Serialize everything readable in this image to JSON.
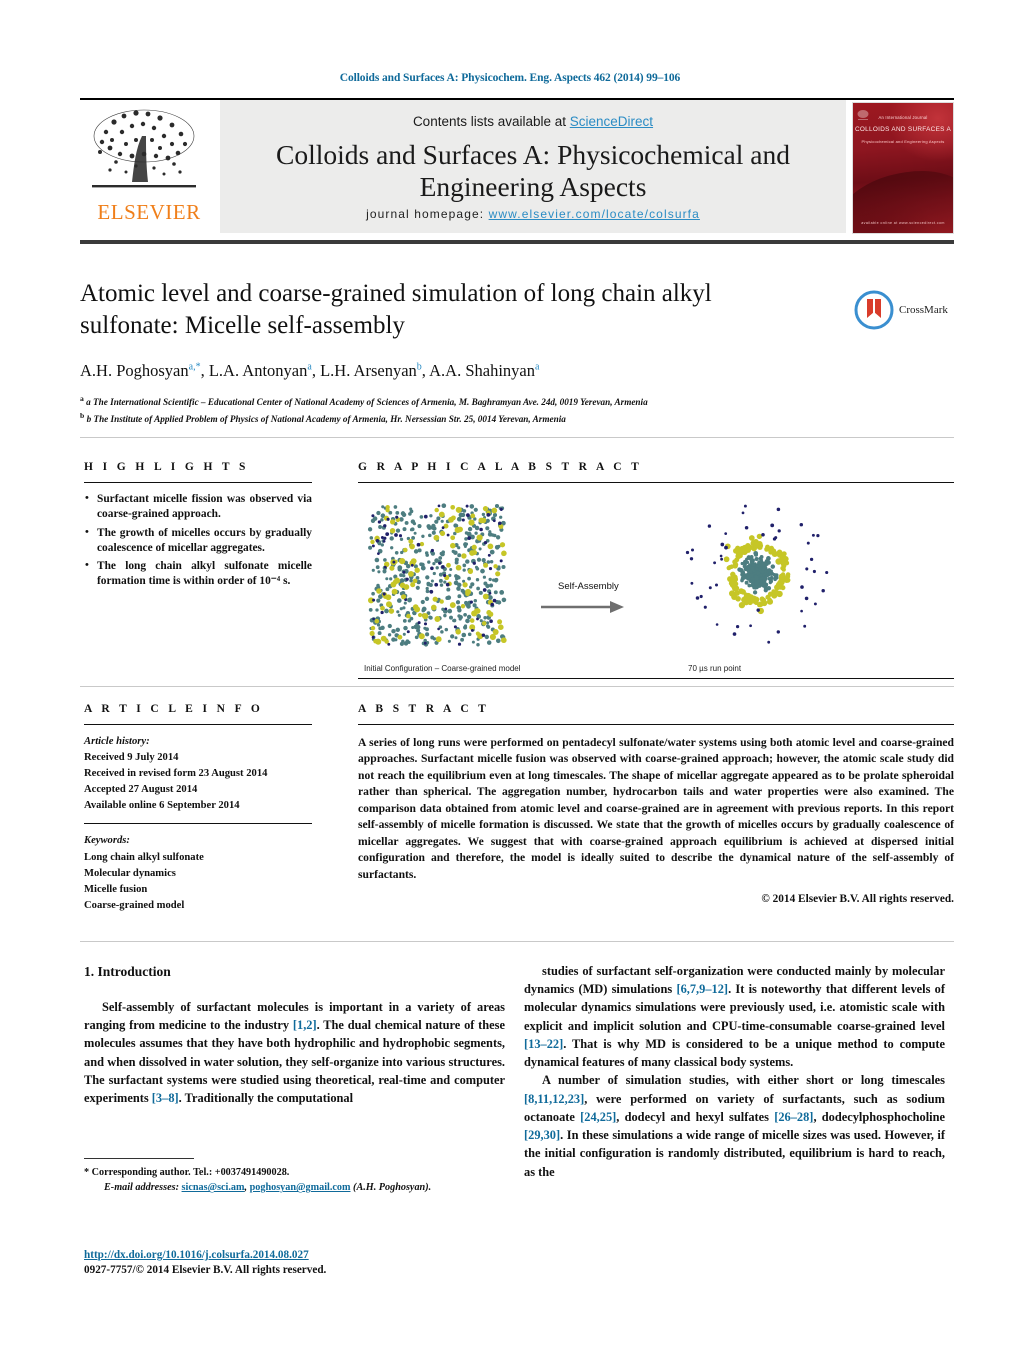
{
  "running_head": "Colloids and Surfaces A: Physicochem. Eng. Aspects 462 (2014) 99–106",
  "masthead": {
    "contents_prefix": "Contents lists available at ",
    "sciencedirect": "ScienceDirect",
    "journal_title": "Colloids and Surfaces A: Physicochemical and Engineering Aspects",
    "homepage_label": "journal homepage:",
    "homepage_url": "www.elsevier.com/locate/colsurfa",
    "publisher": "ELSEVIER",
    "cover": {
      "kicker": "An International Journal",
      "title": "COLLOIDS AND SURFACES A",
      "subtitle": "Physicochemical and Engineering Aspects",
      "footer": "available online at www.sciencedirect.com"
    }
  },
  "article": {
    "title": "Atomic level and coarse-grained simulation of long chain alkyl sulfonate: Micelle self-assembly",
    "crossmark_label": "CrossMark",
    "authors_html": "A.H. Poghosyan<sup>a,*</sup>, L.A. Antonyan<sup>a</sup>, L.H. Arsenyan<sup>b</sup>, A.A. Shahinyan<sup>a</sup>",
    "affiliations": [
      "a The International Scientific – Educational Center of National Academy of Sciences of Armenia, M. Baghramyan Ave. 24d, 0019 Yerevan, Armenia",
      "b The Institute of Applied Problem of Physics of National Academy of Armenia, Hr. Nersessian Str. 25, 0014 Yerevan, Armenia"
    ]
  },
  "highlights": {
    "heading": "H I G H L I G H T S",
    "items": [
      "Surfactant micelle fission was observed via coarse-grained approach.",
      "The growth of micelles occurs by gradually coalescence of micellar aggregates.",
      "The long chain alkyl sulfonate micelle formation time is within order of 10⁻⁴ s."
    ]
  },
  "graphical_abstract": {
    "heading": "G R A P H I C A L   A B S T R A C T",
    "arrow_label": "Self-Assembly",
    "caption_left": "Initial Configuration – Coarse-grained model",
    "caption_right": "70 µs run point",
    "colors": {
      "head_bead": "#c6c627",
      "tail_bead": "#4d7d80",
      "water_bead": "#20206a"
    }
  },
  "article_info": {
    "heading": "A R T I C L E   I N F O",
    "history_label": "Article history:",
    "history": [
      "Received 9 July 2014",
      "Received in revised form 23 August 2014",
      "Accepted 27 August 2014",
      "Available online 6 September 2014"
    ],
    "keywords_label": "Keywords:",
    "keywords": [
      "Long chain alkyl sulfonate",
      "Molecular dynamics",
      "Micelle fusion",
      "Coarse-grained model"
    ]
  },
  "abstract": {
    "heading": "A B S T R A C T",
    "text": "A series of long runs were performed on pentadecyl sulfonate/water systems using both atomic level and coarse-grained approaches. Surfactant micelle fusion was observed with coarse-grained approach; however, the atomic scale study did not reach the equilibrium even at long timescales. The shape of micellar aggregate appeared as to be prolate spheroidal rather than spherical. The aggregation number, hydrocarbon tails and water properties were also examined. The comparison data obtained from atomic level and coarse-grained are in agreement with previous reports. In this report self-assembly of micelle formation is discussed. We state that the growth of micelles occurs by gradually coalescence of micellar aggregates. We suggest that with coarse-grained approach equilibrium is achieved at dispersed initial configuration and therefore, the model is ideally suited to describe the dynamical nature of the self-assembly of surfactants.",
    "rights": "© 2014 Elsevier B.V. All rights reserved."
  },
  "body": {
    "section_number_title": "1.  Introduction",
    "left_paragraphs": [
      {
        "parts": [
          {
            "t": "Self-assembly of surfactant molecules is important in a variety of areas ranging from medicine to the industry ",
            "ref": false
          },
          {
            "t": "[1,2]",
            "ref": true
          },
          {
            "t": ". The dual chemical nature of these molecules assumes that they have both hydrophilic and hydrophobic segments, and when dissolved in water solution, they self-organize into various structures. The surfactant systems were studied using theoretical, real-time and computer experiments ",
            "ref": false
          },
          {
            "t": "[3–8]",
            "ref": true
          },
          {
            "t": ". Traditionally the computational",
            "ref": false
          }
        ]
      }
    ],
    "right_paragraphs": [
      {
        "parts": [
          {
            "t": "studies of surfactant self-organization were conducted mainly by molecular dynamics (MD) simulations ",
            "ref": false
          },
          {
            "t": "[6,7,9–12]",
            "ref": true
          },
          {
            "t": ". It is noteworthy that different levels of molecular dynamics simulations were previously used, i.e. atomistic scale with explicit and implicit solution and CPU-time-consumable coarse-grained level ",
            "ref": false
          },
          {
            "t": "[13–22]",
            "ref": true
          },
          {
            "t": ". That is why MD is considered to be a unique method to compute dynamical features of many classical body systems.",
            "ref": false
          }
        ]
      },
      {
        "parts": [
          {
            "t": "A number of simulation studies, with either short or long timescales ",
            "ref": false
          },
          {
            "t": "[8,11,12,23]",
            "ref": true
          },
          {
            "t": ", were performed on variety of surfactants, such as sodium octanoate ",
            "ref": false
          },
          {
            "t": "[24,25]",
            "ref": true
          },
          {
            "t": ", dodecyl and hexyl sulfates ",
            "ref": false
          },
          {
            "t": "[26–28]",
            "ref": true
          },
          {
            "t": ", dodecylphosphocholine ",
            "ref": false
          },
          {
            "t": "[29,30]",
            "ref": true
          },
          {
            "t": ". In these simulations a wide range of micelle sizes was used. However, if the initial configuration is randomly distributed, equilibrium is hard to reach, as the",
            "ref": false
          }
        ]
      }
    ]
  },
  "footnote": {
    "corresponding": "*  Corresponding author. Tel.: +0037491490028.",
    "email_label": "E-mail addresses:",
    "email1": "sicnas@sci.am",
    "email_sep": ", ",
    "email2": "poghosyan@gmail.com",
    "email_suffix": " (A.H. Poghosyan)."
  },
  "footer": {
    "doi": "http://dx.doi.org/10.1016/j.colsurfa.2014.08.027",
    "issn_rights": "0927-7757/© 2014 Elsevier B.V. All rights reserved."
  }
}
